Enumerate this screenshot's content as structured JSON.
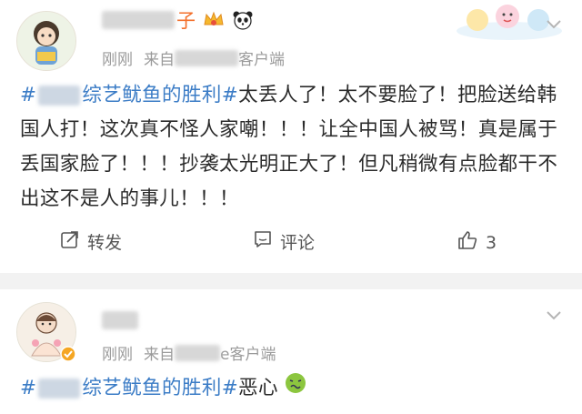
{
  "post1": {
    "username_suffix": "子",
    "time": "刚刚",
    "source_prefix": "来自",
    "source_suffix": "客户端",
    "body": {
      "topic_start": "#",
      "topic_end": "综艺鱿鱼的胜利#",
      "text": "太丢人了！太不要脸了！把脸送给韩国人打！这次真不怪人家嘲！！！让全中国人被骂！真是属于丢国家脸了！！！抄袭太光明正大了！但凡稍微有点脸都干不出这不是人的事儿！！！"
    },
    "actions": {
      "repost_label": "转发",
      "comment_label": "评论",
      "like_count": "3"
    }
  },
  "post2": {
    "time": "刚刚",
    "source_prefix": "来自",
    "source_suffix": "e客户端",
    "body": {
      "topic_start": "#",
      "topic_end": "综艺鱿鱼的胜利#",
      "text": "恶心"
    }
  },
  "colors": {
    "accent_orange": "#f36f2b",
    "topic_blue": "#3b7cc6",
    "meta_gray": "#9a9a9a",
    "background": "#f2f2f2"
  },
  "icons": [
    "crown-badge-icon",
    "panda-icon",
    "chevron-down-icon",
    "repost-icon",
    "comment-icon",
    "like-icon",
    "verified-icon",
    "nauseated-face-icon"
  ]
}
